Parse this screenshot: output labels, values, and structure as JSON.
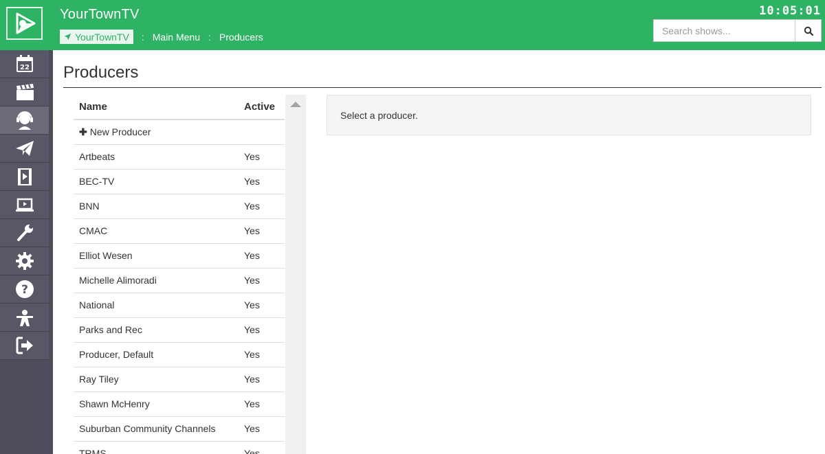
{
  "header": {
    "app_title": "YourTownTV",
    "clock": "10:05:01",
    "search_placeholder": "Search shows...",
    "breadcrumb": {
      "home": "YourTownTV",
      "separator": ":",
      "items": [
        "Main Menu",
        "Producers"
      ]
    }
  },
  "sidebar": {
    "calendar_day": "22",
    "items": [
      {
        "icon": "calendar-icon"
      },
      {
        "icon": "clapperboard-icon"
      },
      {
        "icon": "producer-headset-icon",
        "active": true
      },
      {
        "icon": "paper-plane-icon"
      },
      {
        "icon": "film-play-icon"
      },
      {
        "icon": "laptop-play-icon"
      },
      {
        "icon": "wrench-icon"
      },
      {
        "icon": "gear-icon"
      },
      {
        "icon": "help-icon"
      },
      {
        "icon": "user-directory-icon"
      },
      {
        "icon": "sign-out-icon"
      }
    ]
  },
  "page": {
    "title": "Producers"
  },
  "table": {
    "headers": {
      "name": "Name",
      "active": "Active"
    },
    "new_producer": "New Producer",
    "rows": [
      {
        "name": "Artbeats",
        "active": "Yes"
      },
      {
        "name": "BEC-TV",
        "active": "Yes"
      },
      {
        "name": "BNN",
        "active": "Yes"
      },
      {
        "name": "CMAC",
        "active": "Yes"
      },
      {
        "name": "Elliot Wesen",
        "active": "Yes"
      },
      {
        "name": "Michelle Alimoradi",
        "active": "Yes"
      },
      {
        "name": "National",
        "active": "Yes"
      },
      {
        "name": "Parks and Rec",
        "active": "Yes"
      },
      {
        "name": "Producer, Default",
        "active": "Yes"
      },
      {
        "name": "Ray Tiley",
        "active": "Yes"
      },
      {
        "name": "Shawn McHenry",
        "active": "Yes"
      },
      {
        "name": "Suburban Community Channels",
        "active": "Yes"
      },
      {
        "name": "TRMS",
        "active": "Yes"
      }
    ]
  },
  "detail": {
    "message": "Select a producer."
  },
  "colors": {
    "brand_green": "#2eb365",
    "sidebar_bg": "#4d4d5c",
    "sidebar_item": "#575766",
    "sidebar_active": "#6b6b78"
  }
}
